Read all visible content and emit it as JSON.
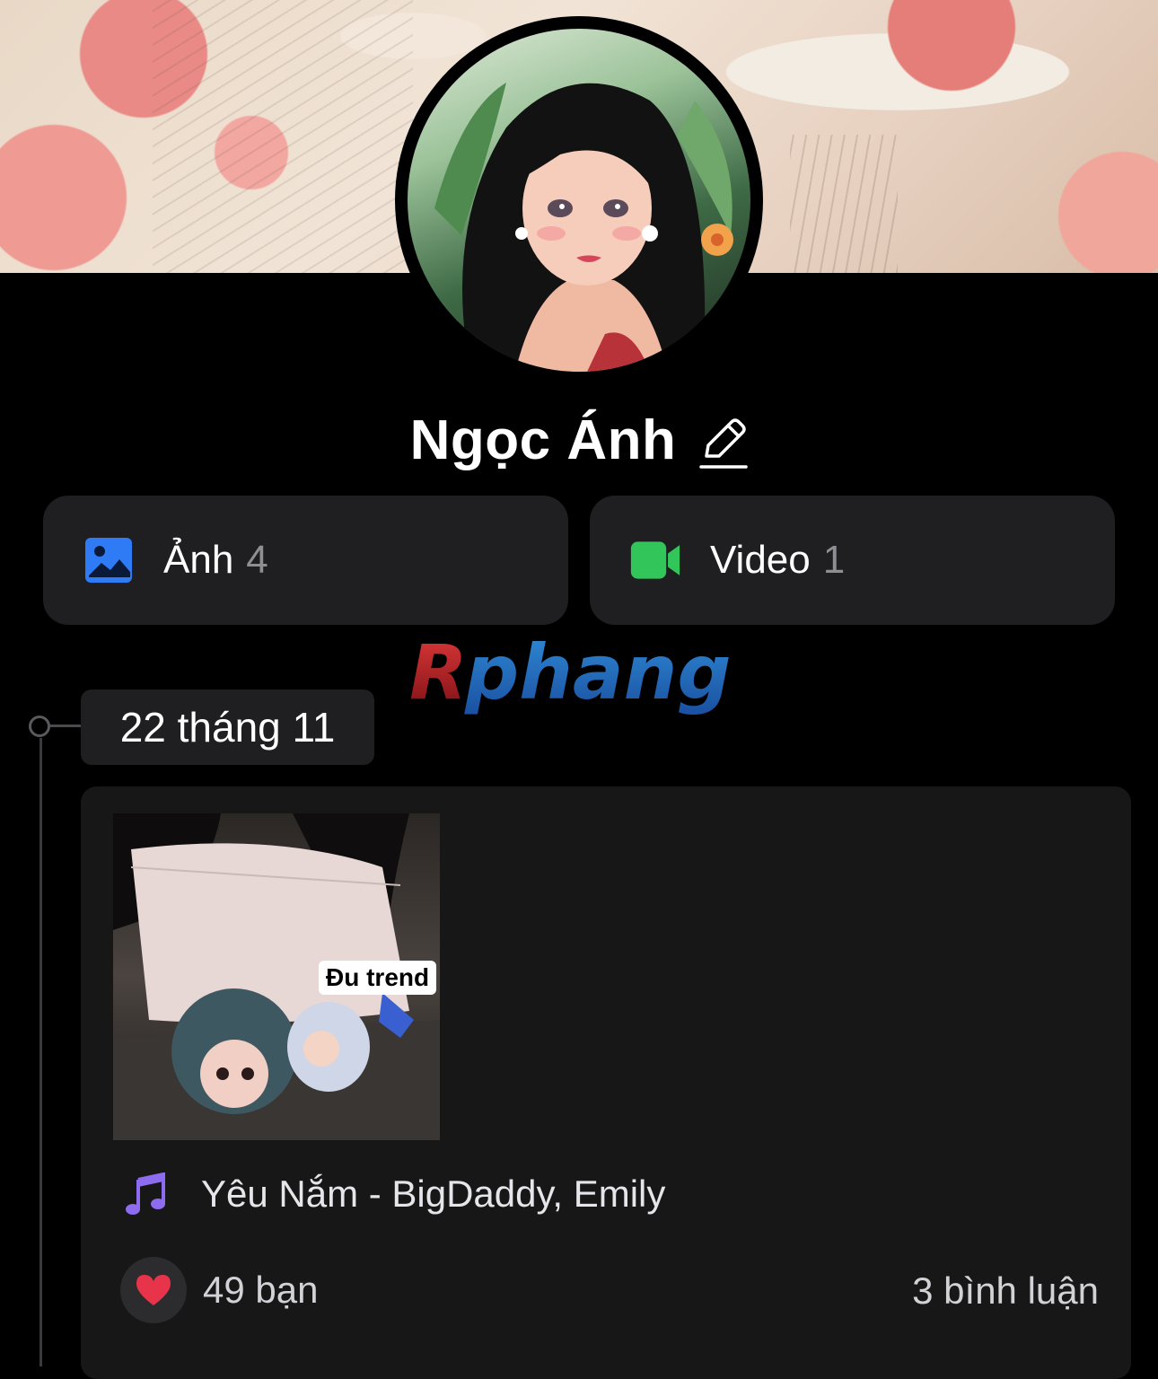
{
  "profile": {
    "name": "Ngọc Ánh",
    "edit_icon": "pencil-icon"
  },
  "stats": {
    "photos": {
      "label": "Ảnh",
      "count": "4",
      "icon": "photo-icon",
      "color": "#2f7bf6"
    },
    "videos": {
      "label": "Video",
      "count": "1",
      "icon": "video-camera-icon",
      "color": "#31c55a"
    }
  },
  "watermark": {
    "text": "Rphang"
  },
  "timeline": {
    "date": "22 tháng 11"
  },
  "post": {
    "tag": "Đu trend",
    "music": {
      "icon": "music-note-icon",
      "text": "Yêu Nắm - BigDaddy, Emily",
      "color": "#8e6cf0"
    },
    "likes": {
      "icon": "heart-icon",
      "text": "49 bạn",
      "color": "#e8344b"
    },
    "comments": "3 bình luận"
  }
}
